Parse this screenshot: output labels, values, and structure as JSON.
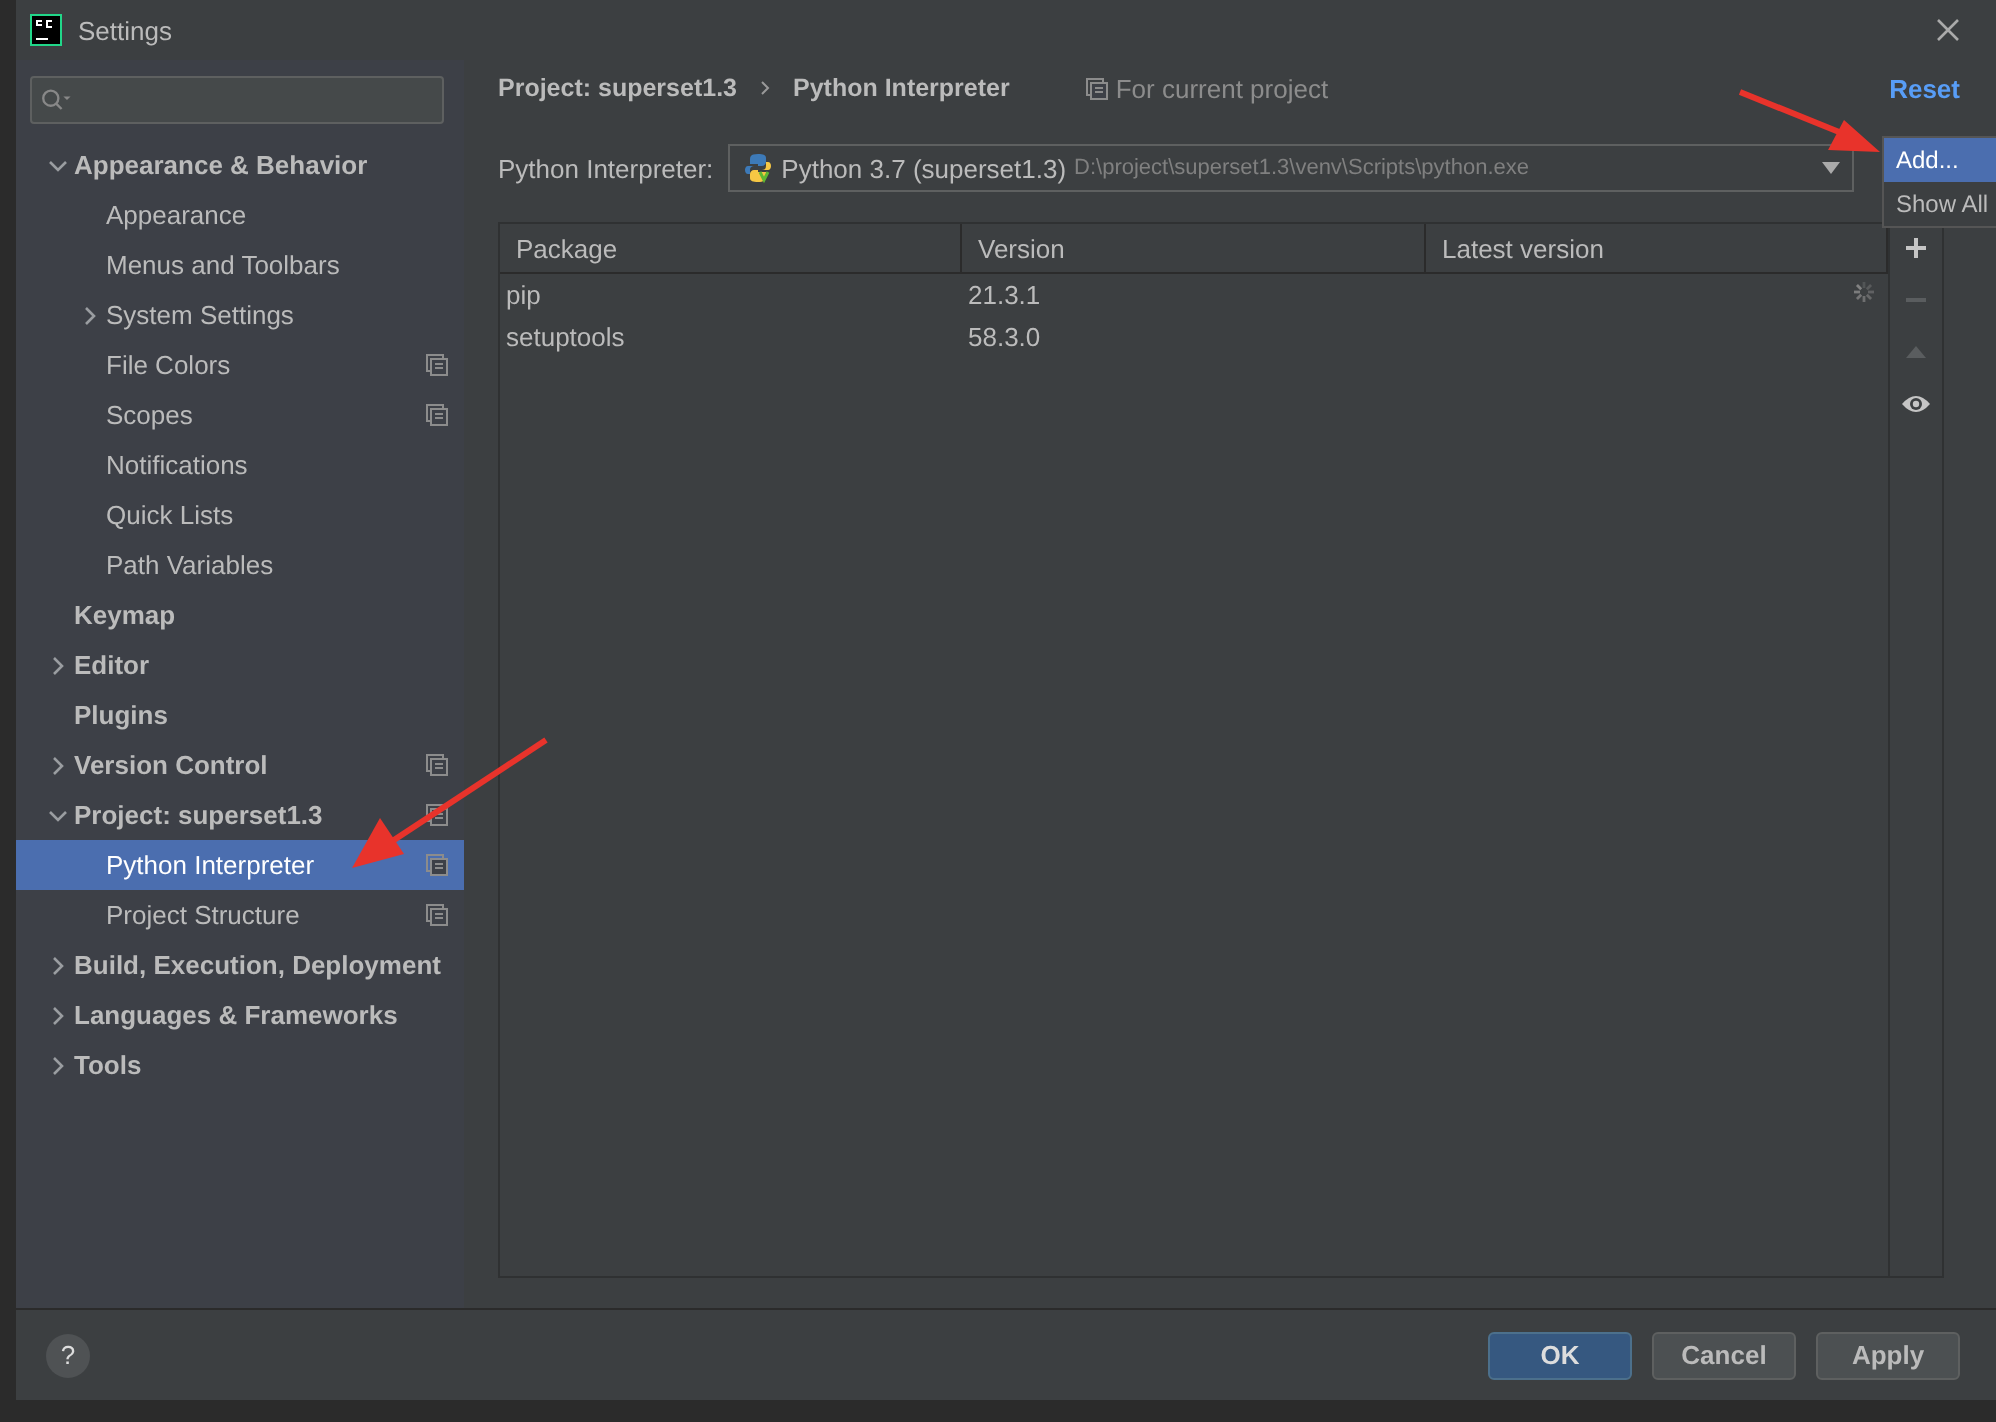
{
  "window": {
    "title": "Settings"
  },
  "help": "?",
  "sidebar": {
    "items": [
      {
        "label": "Appearance & Behavior",
        "expanded": true,
        "selected": false,
        "children": [
          {
            "label": "Appearance",
            "selected": false
          },
          {
            "label": "Menus and Toolbars",
            "selected": false
          },
          {
            "label": "System Settings",
            "expanded": false,
            "selected": false
          },
          {
            "label": "File Colors",
            "scoped": true,
            "selected": false
          },
          {
            "label": "Scopes",
            "scoped": true,
            "selected": false
          },
          {
            "label": "Notifications",
            "selected": false
          },
          {
            "label": "Quick Lists",
            "selected": false
          },
          {
            "label": "Path Variables",
            "selected": false
          }
        ]
      },
      {
        "label": "Keymap",
        "selected": false
      },
      {
        "label": "Editor",
        "expanded": false,
        "selected": false
      },
      {
        "label": "Plugins",
        "selected": false
      },
      {
        "label": "Version Control",
        "expanded": false,
        "scoped": true,
        "selected": false
      },
      {
        "label": "Project: superset1.3",
        "expanded": true,
        "scoped": true,
        "selected": false,
        "children": [
          {
            "label": "Python Interpreter",
            "scoped": true,
            "selected": true
          },
          {
            "label": "Project Structure",
            "scoped": true,
            "selected": false
          }
        ]
      },
      {
        "label": "Build, Execution, Deployment",
        "expanded": false,
        "selected": false
      },
      {
        "label": "Languages & Frameworks",
        "expanded": false,
        "selected": false
      },
      {
        "label": "Tools",
        "expanded": false,
        "selected": false
      }
    ]
  },
  "breadcrumb": [
    "Project: superset1.3",
    "Python Interpreter"
  ],
  "scope_note": "For current project",
  "reset": "Reset",
  "interpreter": {
    "label": "Python Interpreter:",
    "name": "Python 3.7 (superset1.3)",
    "path": "D:\\project\\superset1.3\\venv\\Scripts\\python.exe"
  },
  "popup": {
    "items": [
      {
        "label": "Add...",
        "selected": true
      },
      {
        "label": "Show All",
        "selected": false
      }
    ]
  },
  "table": {
    "columns": [
      "Package",
      "Version",
      "Latest version"
    ],
    "rows": [
      [
        "pip",
        "21.3.1",
        ""
      ],
      [
        "setuptools",
        "58.3.0",
        ""
      ]
    ],
    "loading": true
  },
  "tools": [
    {
      "kind": "add",
      "disabled": false
    },
    {
      "kind": "remove",
      "disabled": true
    },
    {
      "kind": "upgrade",
      "disabled": true
    },
    {
      "kind": "show",
      "disabled": false
    }
  ],
  "buttons": [
    {
      "label": "OK",
      "primary": true
    },
    {
      "label": "Cancel",
      "primary": false
    },
    {
      "label": "Apply",
      "primary": false
    }
  ]
}
